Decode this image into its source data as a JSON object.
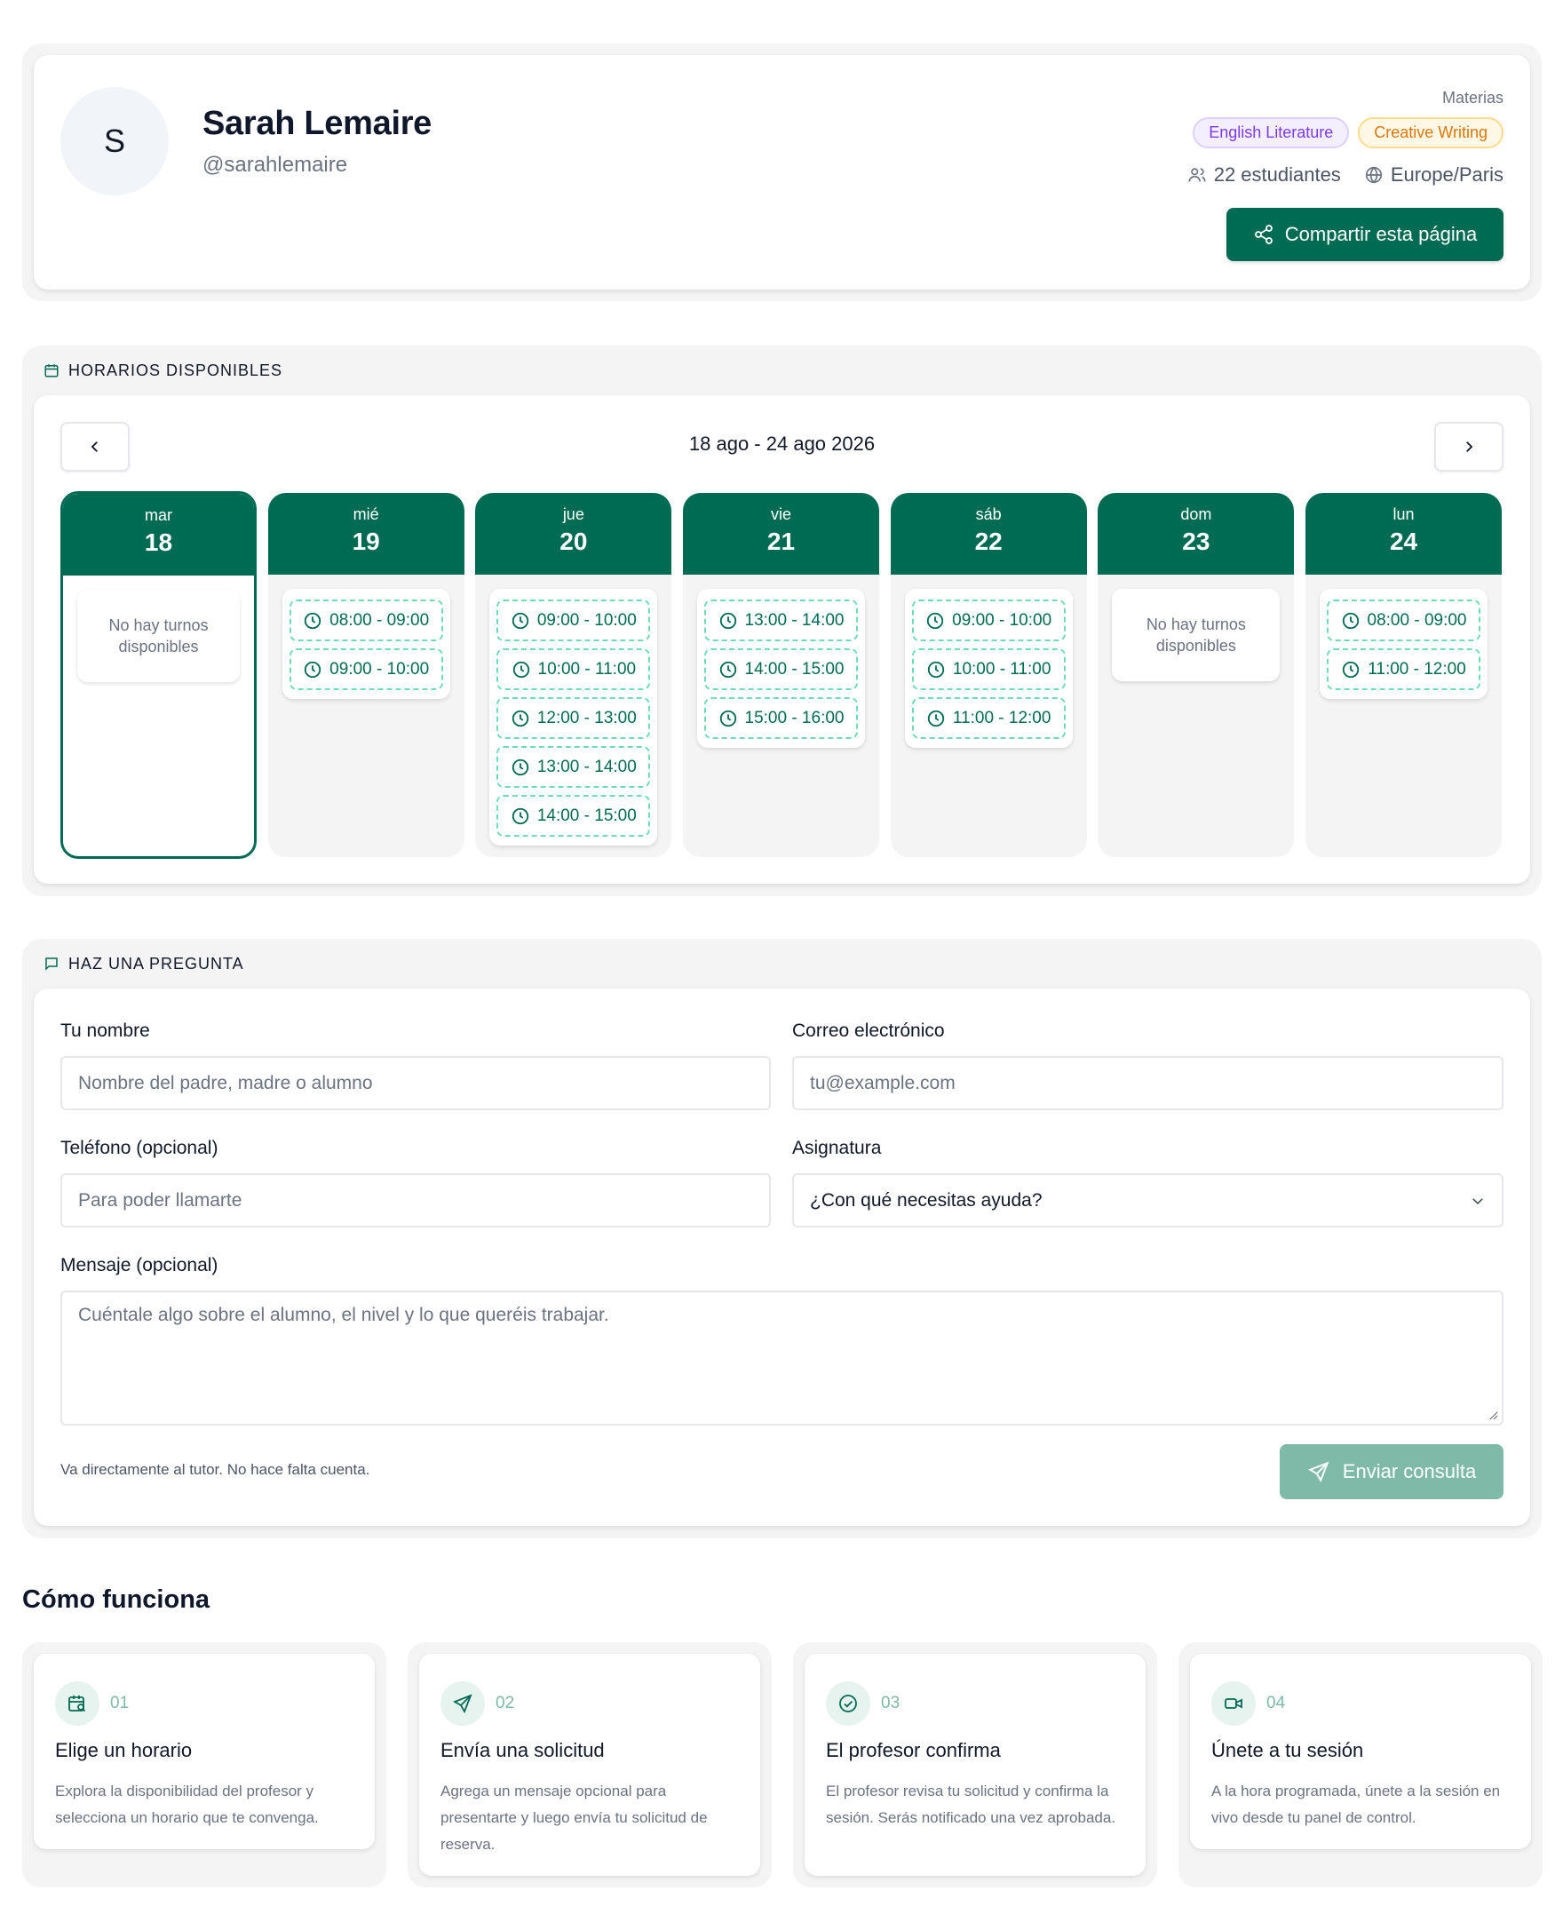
{
  "profile": {
    "initial": "S",
    "name": "Sarah Lemaire",
    "handle": "@sarahlemaire",
    "subjects_label": "Materias",
    "subjects": [
      "English Literature",
      "Creative Writing"
    ],
    "students": "22 estudiantes",
    "timezone": "Europe/Paris",
    "share_label": "Compartir esta página"
  },
  "schedule": {
    "section_title": "HORARIOS DISPONIBLES",
    "range": "18 ago - 24 ago 2026",
    "empty_text": "No hay turnos disponibles",
    "days": [
      {
        "name": "mar",
        "date": "18",
        "selected": true,
        "slots": []
      },
      {
        "name": "mié",
        "date": "19",
        "slots": [
          "08:00 - 09:00",
          "09:00 - 10:00"
        ]
      },
      {
        "name": "jue",
        "date": "20",
        "slots": [
          "09:00 - 10:00",
          "10:00 - 11:00",
          "12:00 - 13:00",
          "13:00 - 14:00",
          "14:00 - 15:00"
        ]
      },
      {
        "name": "vie",
        "date": "21",
        "slots": [
          "13:00 - 14:00",
          "14:00 - 15:00",
          "15:00 - 16:00"
        ]
      },
      {
        "name": "sáb",
        "date": "22",
        "slots": [
          "09:00 - 10:00",
          "10:00 - 11:00",
          "11:00 - 12:00"
        ]
      },
      {
        "name": "dom",
        "date": "23",
        "slots": []
      },
      {
        "name": "lun",
        "date": "24",
        "slots": [
          "08:00 - 09:00",
          "11:00 - 12:00"
        ]
      }
    ]
  },
  "form": {
    "section_title": "HAZ UNA PREGUNTA",
    "name_label": "Tu nombre",
    "name_placeholder": "Nombre del padre, madre o alumno",
    "email_label": "Correo electrónico",
    "email_placeholder": "tu@example.com",
    "phone_label": "Teléfono (opcional)",
    "phone_placeholder": "Para poder llamarte",
    "subject_label": "Asignatura",
    "subject_value": "¿Con qué necesitas ayuda?",
    "message_label": "Mensaje (opcional)",
    "message_placeholder": "Cuéntale algo sobre el alumno, el nivel y lo que queréis trabajar.",
    "hint": "Va directamente al tutor. No hace falta cuenta.",
    "submit_label": "Enviar consulta"
  },
  "how": {
    "title": "Cómo funciona",
    "steps": [
      {
        "num": "01",
        "icon": "calendar-search-icon",
        "title": "Elige un horario",
        "desc": "Explora la disponibilidad del profesor y selecciona un horario que te convenga."
      },
      {
        "num": "02",
        "icon": "send-icon",
        "title": "Envía una solicitud",
        "desc": "Agrega un mensaje opcional para presentarte y luego envía tu solicitud de reserva."
      },
      {
        "num": "03",
        "icon": "check-circle-icon",
        "title": "El profesor confirma",
        "desc": "El profesor revisa tu solicitud y confirma la sesión. Serás notificado una vez aprobada."
      },
      {
        "num": "04",
        "icon": "video-icon",
        "title": "Únete a tu sesión",
        "desc": "A la hora programada, únete a la sesión en vivo desde tu panel de control."
      }
    ]
  },
  "colors": {
    "primary": "#006b53",
    "primary_muted": "#7fb9a8",
    "slot_border": "#6fdcb8"
  }
}
